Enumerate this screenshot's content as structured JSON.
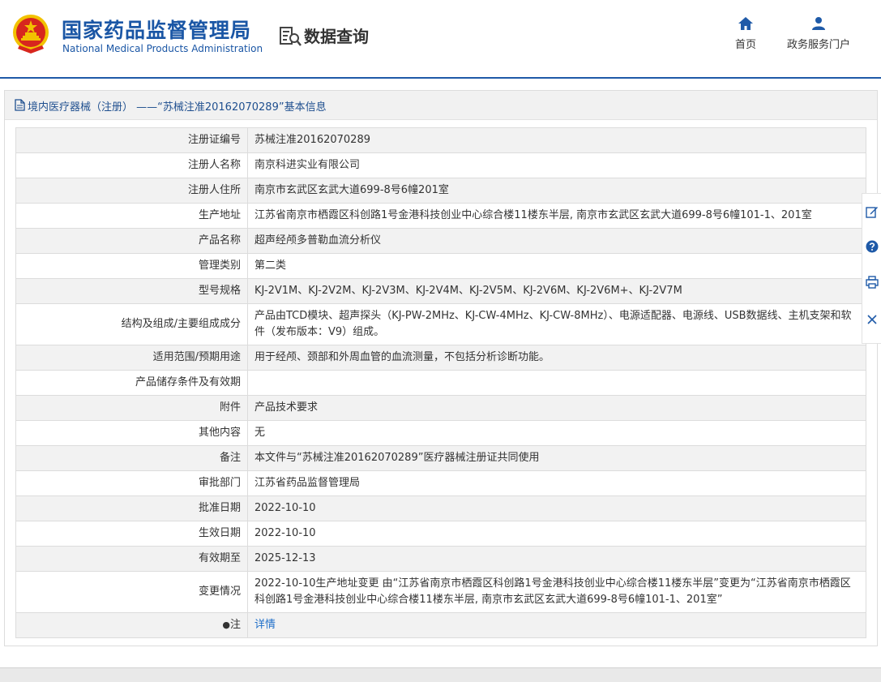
{
  "header": {
    "brand_cn": "国家药品监督管理局",
    "brand_en": "National Medical Products Administration",
    "query_title": "数据查询",
    "nav": {
      "home_label": "首页",
      "gov_label": "政务服务门户"
    }
  },
  "breadcrumb": {
    "text": "境内医疗器械（注册） ——“苏械注准20162070289”基本信息"
  },
  "rows": [
    {
      "label": "注册证编号",
      "value": "苏械注准20162070289"
    },
    {
      "label": "注册人名称",
      "value": "南京科进实业有限公司"
    },
    {
      "label": "注册人住所",
      "value": "南京市玄武区玄武大道699-8号6幢201室"
    },
    {
      "label": "生产地址",
      "value": "江苏省南京市栖霞区科创路1号金港科技创业中心综合楼11楼东半层, 南京市玄武区玄武大道699-8号6幢101-1、201室"
    },
    {
      "label": "产品名称",
      "value": "超声经颅多普勒血流分析仪"
    },
    {
      "label": "管理类别",
      "value": "第二类"
    },
    {
      "label": "型号规格",
      "value": "KJ-2V1M、KJ-2V2M、KJ-2V3M、KJ-2V4M、KJ-2V5M、KJ-2V6M、KJ-2V6M+、KJ-2V7M"
    },
    {
      "label": "结构及组成/主要组成成分",
      "value": "产品由TCD模块、超声探头（KJ-PW-2MHz、KJ-CW-4MHz、KJ-CW-8MHz）、电源适配器、电源线、USB数据线、主机支架和软件（发布版本：V9）组成。"
    },
    {
      "label": "适用范围/预期用途",
      "value": "用于经颅、颈部和外周血管的血流测量，不包括分析诊断功能。"
    },
    {
      "label": "产品储存条件及有效期",
      "value": ""
    },
    {
      "label": "附件",
      "value": "产品技术要求"
    },
    {
      "label": "其他内容",
      "value": "无"
    },
    {
      "label": "备注",
      "value": "本文件与“苏械注准20162070289”医疗器械注册证共同使用"
    },
    {
      "label": "审批部门",
      "value": "江苏省药品监督管理局"
    },
    {
      "label": "批准日期",
      "value": "2022-10-10"
    },
    {
      "label": "生效日期",
      "value": "2022-10-10"
    },
    {
      "label": "有效期至",
      "value": "2025-12-13"
    },
    {
      "label": "变更情况",
      "value": "2022-10-10生产地址变更 由“江苏省南京市栖霞区科创路1号金港科技创业中心综合楼11楼东半层”变更为“江苏省南京市栖霞区科创路1号金港科技创业中心综合楼11楼东半层, 南京市玄武区玄武大道699-8号6幢101-1、201室”"
    }
  ],
  "note_row": {
    "pin_glyph": "●",
    "label": "注",
    "link": "详情"
  },
  "colors": {
    "brand_blue": "#1a56a5",
    "link_blue": "#1f6fc9",
    "emblem_red": "#d7261e",
    "emblem_gold": "#f2c200"
  },
  "icons": [
    "national-emblem-icon",
    "search-document-icon",
    "home-icon",
    "user-icon",
    "document-icon",
    "edit-icon",
    "help-icon",
    "print-icon",
    "close-icon"
  ]
}
